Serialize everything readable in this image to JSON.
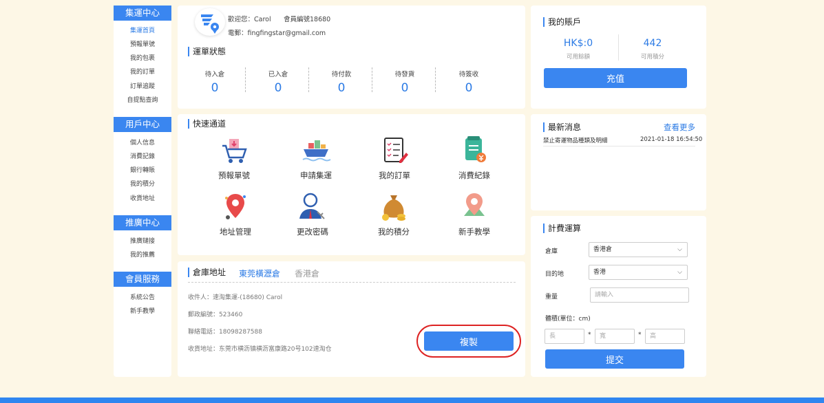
{
  "sidebar": {
    "sections": [
      {
        "title": "集運中心",
        "items": [
          "集運首頁",
          "預報單號",
          "我的包裹",
          "我的訂單",
          "訂單追蹤",
          "自提點查詢"
        ]
      },
      {
        "title": "用戶中心",
        "items": [
          "個人信息",
          "消費記錄",
          "銀行轉賬",
          "我的積分",
          "收貨地址"
        ]
      },
      {
        "title": "推廣中心",
        "items": [
          "推廣鏈接",
          "我的推薦"
        ]
      },
      {
        "title": "會員服務",
        "items": [
          "系統公告",
          "新手教學"
        ]
      }
    ]
  },
  "user": {
    "welcome": "歡迎您：Carol",
    "member_no": "會員編號18680",
    "email": "電郵：fingfingstar@gmail.com"
  },
  "order_status": {
    "title": "運單狀態",
    "items": [
      {
        "label": "待入倉",
        "value": "0"
      },
      {
        "label": "已入倉",
        "value": "0"
      },
      {
        "label": "待付款",
        "value": "0"
      },
      {
        "label": "待發貨",
        "value": "0"
      },
      {
        "label": "待簽收",
        "value": "0"
      }
    ]
  },
  "quick": {
    "title": "快速通道",
    "items": [
      "預報單號",
      "申請集運",
      "我的訂單",
      "消費紀錄",
      "地址管理",
      "更改密碼",
      "我的積分",
      "新手教學"
    ]
  },
  "warehouse": {
    "title": "倉庫地址",
    "tabs": [
      "東莞橫瀝倉",
      "香港倉"
    ],
    "receiver": "收件人：速淘集運-(18680) Carol",
    "postcode": "郵政編號：523460",
    "phone": "聯絡電話：18098287588",
    "address": "收貨地址：东莞市横沥镇横沥富康路20号102速淘仓",
    "copy_label": "複製"
  },
  "account": {
    "title": "我的賬戶",
    "balance": "HK$:0",
    "balance_label": "可用餘額",
    "points": "442",
    "points_label": "可用積分",
    "topup_label": "充值"
  },
  "news": {
    "title": "最新消息",
    "more": "查看更多",
    "items": [
      {
        "text": "禁止寄運物品種類及明細",
        "date": "2021-01-18 16:54:50"
      }
    ]
  },
  "calc": {
    "title": "計費運算",
    "warehouse_label": "倉庫",
    "warehouse_value": "香港倉",
    "dest_label": "目的地",
    "dest_value": "香港",
    "weight_label": "重量",
    "weight_placeholder": "請輸入",
    "volume_label": "體積(單位：cm)",
    "len_ph": "長",
    "width_ph": "寬",
    "height_ph": "高",
    "star": "*",
    "submit_label": "提交"
  },
  "colors": {
    "accent": "#3a86f0",
    "background": "#fdf7e6",
    "highlight_ring": "#d22222"
  }
}
